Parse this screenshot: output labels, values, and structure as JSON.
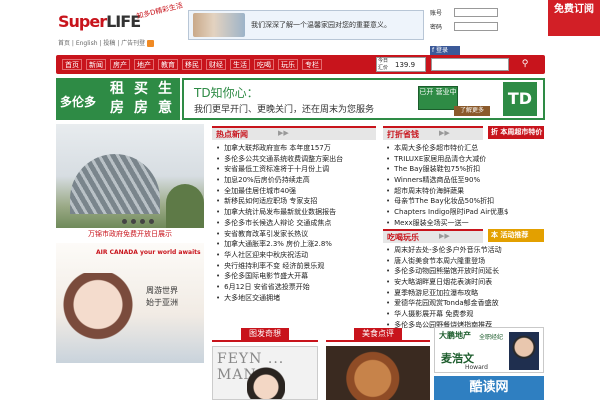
{
  "header": {
    "logo_text": "Super",
    "logo_life": "LIFE",
    "logo_cn": "超级生活",
    "slogan": "知多D精彩生活",
    "top_links": "首页 | English | 投稿 | 广告刊登",
    "banner_text": "我们深深了解一个温馨家园对您的重要意义。",
    "login": {
      "user_label": "账号",
      "pass_label": "密码",
      "fb_label": "f 登录"
    },
    "subscribe": "免费订阅"
  },
  "nav": {
    "items": [
      "首页",
      "新闻",
      "房产",
      "地产",
      "教育",
      "移民",
      "财经",
      "生活",
      "吃喝",
      "玩乐",
      "专栏"
    ],
    "rate_label": "今日汇价",
    "rate_value": "139.9",
    "search_placeholder": ""
  },
  "promo": {
    "city": "多伦多",
    "chars": [
      "租房",
      "买房",
      "生意"
    ],
    "td_title": "TD知你心：",
    "td_sub": "我们更早开门、更晚关门，还在周末为您服务",
    "td_sign": "已开 营业中",
    "td_more": "了解更多",
    "td_logo": "TD"
  },
  "left": {
    "photo_caption": "万锦市政府免费开放日展示",
    "ad_brand": "AIR CANADA  your world awaits",
    "ad_line1": "周游世界",
    "ad_line2": "始于亚洲"
  },
  "hot_news": {
    "title": "热点新闻",
    "items": [
      "加拿大联邦政府宣布 本年度157万",
      "多伦多公共交通系统收费调整方案出台",
      "安省最低工资标准将于十月份上调",
      "加息20%后房价仍持续走高",
      "全加最佳居住城市40强",
      "新移民如何适应职场 专家支招",
      "加拿大统计局发布最新就业数据报告",
      "多伦多市长候选人辩论 交通成焦点",
      "安省教育改革引发家长热议",
      "加拿大通胀率2.3% 房价上涨2.8%",
      "华人社区迎来中秋庆祝活动",
      "央行维持利率不变 经济前景乐观",
      "多伦多国际电影节盛大开幕",
      "6月12日 安省省选投票开始",
      "大多地区交通拥堵"
    ]
  },
  "deals": {
    "title": "打折省钱",
    "tag": "折 本周超市特价",
    "items": [
      "本周大多伦多超市特价汇总",
      "TRILUXE家居用品清仓大减价",
      "The Bay服装鞋包75%折扣",
      "Winners精选商品低至90%",
      "超市周末特价海鲜蔬果",
      "母亲节The Bay化妆品50%折扣",
      "Chapters Indigo限时iPad Air优惠$",
      "Mexx服装全场买一送一"
    ]
  },
  "fun": {
    "title": "吃喝玩乐",
    "tag": "本 活动推荐",
    "items": [
      "周末好去处-多伦多户外音乐节活动",
      "唐人街美食节本周六隆重登场",
      "多伦多动物园熊猫馆开放时间延长",
      "安大略湖畔夏日烟花表演时间表",
      "夏季畅游尼亚加拉瀑布攻略",
      "爱德华花园观赏Tonda郁金香盛放",
      "华人摄影展开幕 免费参观",
      "多伦多岛公园野餐烧烤指南推荐"
    ]
  },
  "tiles": {
    "photo_title": "图发奇想",
    "food_title": "美食点评",
    "mag_title": "FEYN ... MAN"
  },
  "ads": {
    "agent_company": "大鹏地产",
    "agent_sub": "全职经纪",
    "agent_name": "麦浩文",
    "agent_en": "Howard",
    "kudu": "酷读网"
  }
}
